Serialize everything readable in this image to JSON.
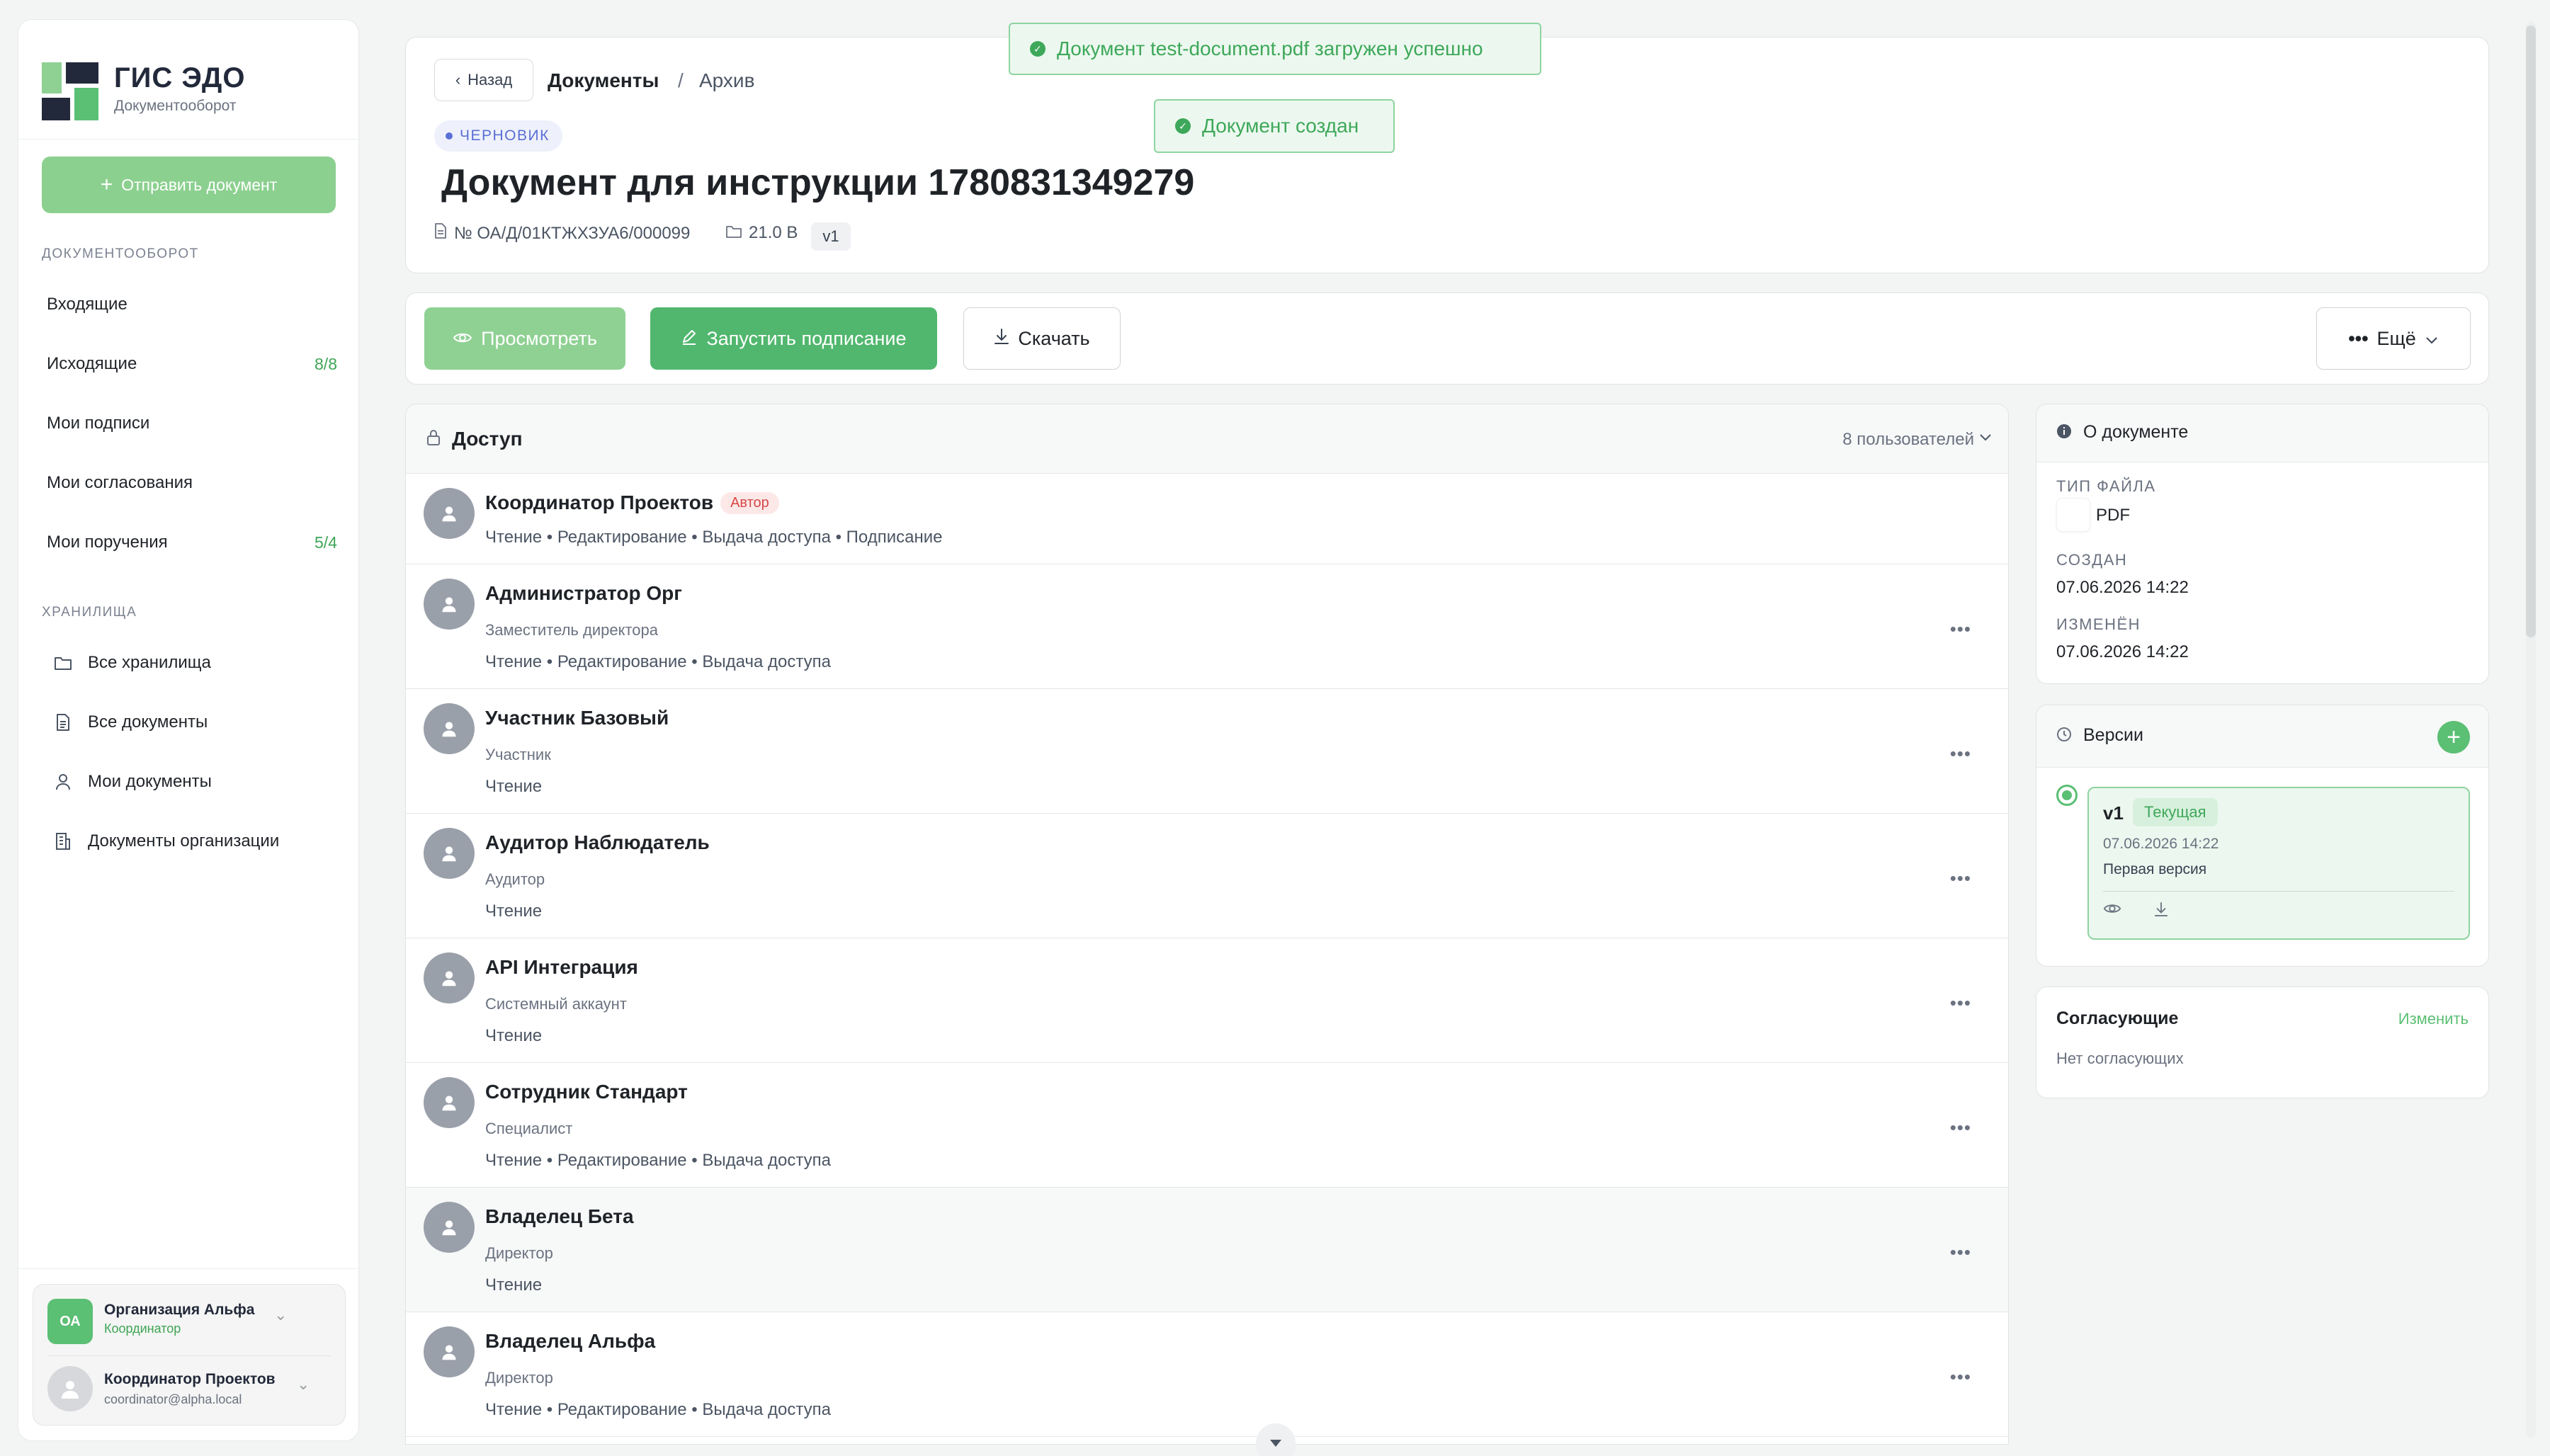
{
  "app": {
    "brand_title": "ГИС ЭДО",
    "brand_subtitle": "Документооборот",
    "logo_colors": [
      "#8fd193",
      "#22293a",
      "#5bbf74"
    ]
  },
  "sidebar": {
    "send_button": "Отправить документ",
    "section_docflow": "ДОКУМЕНТООБОРОТ",
    "docflow_items": [
      {
        "label": "Входящие",
        "count": ""
      },
      {
        "label": "Исходящие",
        "count": "8/8"
      },
      {
        "label": "Мои подписи",
        "count": ""
      },
      {
        "label": "Мои согласования",
        "count": ""
      },
      {
        "label": "Мои поручения",
        "count": "5/4"
      }
    ],
    "section_storage": "ХРАНИЛИЩА",
    "storage_items": [
      {
        "label": "Все хранилища",
        "icon": "folder-icon"
      },
      {
        "label": "Все документы",
        "icon": "document-icon"
      },
      {
        "label": "Мои документы",
        "icon": "user-icon"
      },
      {
        "label": "Документы организации",
        "icon": "building-icon"
      }
    ],
    "org": {
      "initials": "ОА",
      "name": "Организация Альфа",
      "role": "Координатор"
    },
    "user": {
      "name": "Координатор Проектов",
      "email": "coordinator@alpha.local"
    }
  },
  "header": {
    "back": "Назад",
    "breadcrumb": [
      "Документы",
      "/",
      "Архив"
    ],
    "status": "ЧЕРНОВИК",
    "title": "Документ для инструкции 1780831349279",
    "number": "№ ОА/Д/01КТЖХЗУА6/000099",
    "size": "21.0 B",
    "version": "v1"
  },
  "toasts": {
    "uploaded": "Документ test-document.pdf загружен успешно",
    "created": "Документ создан"
  },
  "actions": {
    "view": "Просмотреть",
    "sign": "Запустить подписание",
    "download": "Скачать",
    "more": "Ещё"
  },
  "access": {
    "title": "Доступ",
    "count": "8 пользователей",
    "rows": [
      {
        "name": "Координатор Проектов",
        "badge": "Автор",
        "role": "",
        "perms": "Чтение • Редактирование • Выдача доступа • Подписание"
      },
      {
        "name": "Администратор Орг",
        "role": "Заместитель директора",
        "perms": "Чтение • Редактирование • Выдача доступа"
      },
      {
        "name": "Участник Базовый",
        "role": "Участник",
        "perms": "Чтение"
      },
      {
        "name": "Аудитор Наблюдатель",
        "role": "Аудитор",
        "perms": "Чтение"
      },
      {
        "name": "API Интеграция",
        "role": "Системный аккаунт",
        "perms": "Чтение"
      },
      {
        "name": "Сотрудник Стандарт",
        "role": "Специалист",
        "perms": "Чтение • Редактирование • Выдача доступа"
      },
      {
        "name": "Владелец Бета",
        "role": "Директор",
        "perms": "Чтение"
      },
      {
        "name": "Владелец Альфа",
        "role": "Директор",
        "perms": "Чтение • Редактирование • Выдача доступа"
      }
    ]
  },
  "about": {
    "title": "О документе",
    "file_type_label": "ТИП ФАЙЛА",
    "file_type": "PDF",
    "created_label": "СОЗДАН",
    "created": "07.06.2026 14:22",
    "modified_label": "ИЗМЕНЁН",
    "modified": "07.06.2026 14:22"
  },
  "versions": {
    "title": "Версии",
    "items": [
      {
        "name": "v1",
        "badge": "Текущая",
        "date": "07.06.2026 14:22",
        "desc": "Первая версия"
      }
    ]
  },
  "approvers": {
    "title": "Согласующие",
    "edit": "Изменить",
    "empty": "Нет согласующих"
  }
}
